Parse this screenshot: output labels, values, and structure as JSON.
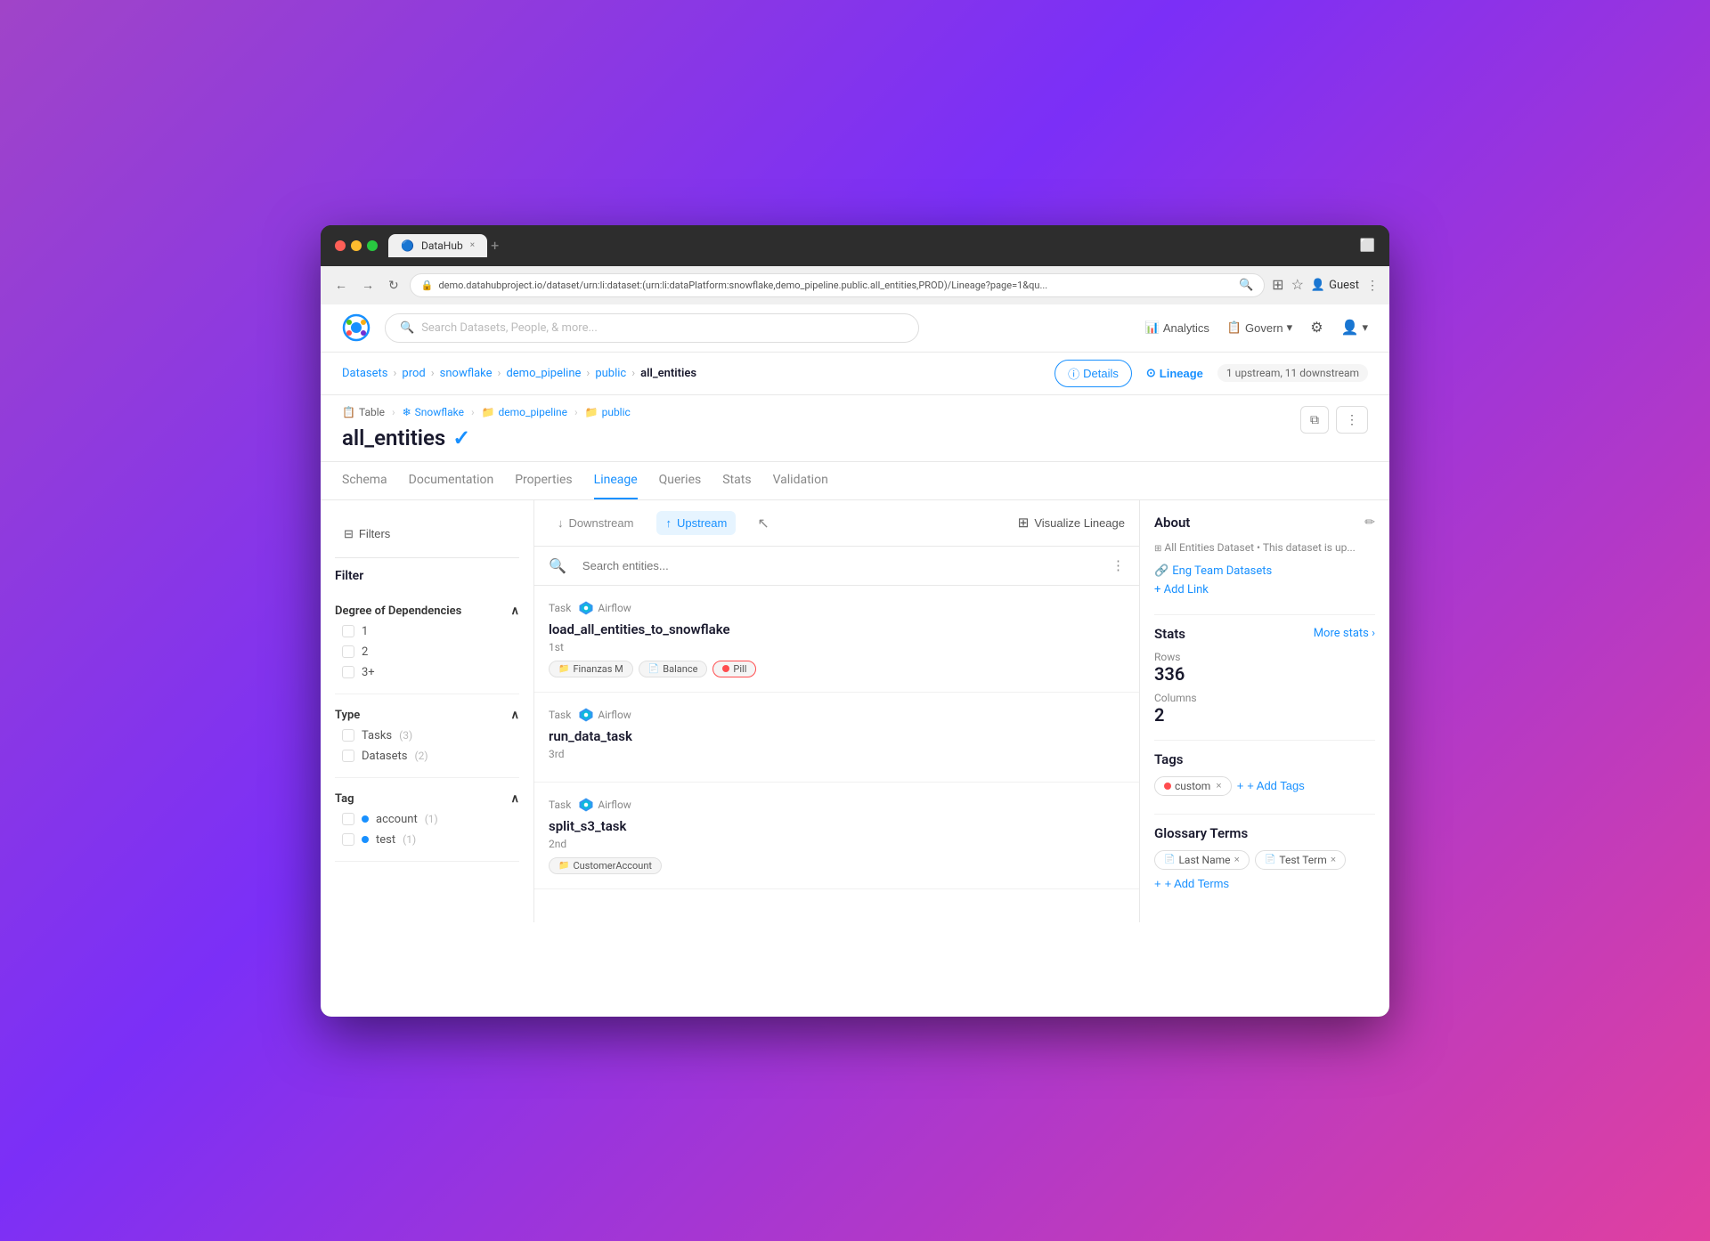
{
  "browser": {
    "tab_title": "DataHub",
    "tab_favicon": "🔵",
    "close_btn": "×",
    "new_tab_btn": "+",
    "url": "demo.datahubproject.io/dataset/urn:li:dataset:(urn:li:dataPlatform:snowflake,demo_pipeline.public.all_entities,PROD)/Lineage?page=1&qu...",
    "nav": {
      "back": "←",
      "forward": "→",
      "refresh": "↻",
      "more": "⋮"
    },
    "guest_label": "Guest",
    "more_btn": "⋮"
  },
  "header": {
    "search_placeholder": "Search Datasets, People, & more...",
    "analytics_label": "Analytics",
    "govern_label": "Govern",
    "settings_icon": "⚙",
    "user_icon": "👤"
  },
  "breadcrumb": {
    "items": [
      "Datasets",
      "prod",
      "snowflake",
      "demo_pipeline",
      "public",
      "all_entities"
    ],
    "separators": [
      ">",
      ">",
      ">",
      ">",
      ">"
    ]
  },
  "entity_nav": {
    "details_label": "Details",
    "lineage_label": "Lineage",
    "lineage_count": "1 upstream, 11 downstream"
  },
  "entity": {
    "meta": {
      "type": "Table",
      "platform": "Snowflake",
      "container1": "demo_pipeline",
      "container2": "public"
    },
    "title": "all_entities",
    "verified": true
  },
  "tabs": [
    {
      "id": "schema",
      "label": "Schema"
    },
    {
      "id": "documentation",
      "label": "Documentation"
    },
    {
      "id": "properties",
      "label": "Properties"
    },
    {
      "id": "lineage",
      "label": "Lineage",
      "active": true
    },
    {
      "id": "queries",
      "label": "Queries"
    },
    {
      "id": "stats",
      "label": "Stats"
    },
    {
      "id": "validation",
      "label": "Validation"
    }
  ],
  "lineage_toolbar": {
    "downstream_label": "Downstream",
    "upstream_label": "Upstream",
    "visualize_label": "Visualize Lineage",
    "active": "upstream"
  },
  "filter_panel": {
    "title": "Filter",
    "filters_label": "Filters",
    "sections": [
      {
        "id": "degree",
        "title": "Degree of Dependencies",
        "options": [
          {
            "label": "1",
            "count": null
          },
          {
            "label": "2",
            "count": null
          },
          {
            "label": "3+",
            "count": null
          }
        ]
      },
      {
        "id": "type",
        "title": "Type",
        "options": [
          {
            "label": "Tasks",
            "count": "(3)"
          },
          {
            "label": "Datasets",
            "count": "(2)"
          }
        ]
      },
      {
        "id": "tag",
        "title": "Tag",
        "options": [
          {
            "label": "account",
            "count": "(1)",
            "color": "#1890ff"
          },
          {
            "label": "test",
            "count": "(1)",
            "color": "#1890ff"
          }
        ]
      }
    ]
  },
  "lineage_items": [
    {
      "type": "Task",
      "platform": "Airflow",
      "name": "load_all_entities_to_snowflake",
      "degree": "1st",
      "tags": [
        {
          "label": "Finanzas M",
          "type": "normal"
        },
        {
          "label": "Balance",
          "type": "normal"
        },
        {
          "label": "Pill",
          "type": "pill",
          "color": "#ff4d4f"
        }
      ]
    },
    {
      "type": "Task",
      "platform": "Airflow",
      "name": "run_data_task",
      "degree": "3rd",
      "tags": []
    },
    {
      "type": "Task",
      "platform": "Airflow",
      "name": "split_s3_task",
      "degree": "2nd",
      "tags": [
        {
          "label": "CustomerAccount",
          "type": "normal"
        }
      ]
    }
  ],
  "right_panel": {
    "about": {
      "title": "About",
      "edit_icon": "✏",
      "entity_name": "All Entities Dataset",
      "description": "This dataset is up...",
      "link": "Eng Team Datasets",
      "add_link_label": "+ Add Link"
    },
    "stats": {
      "title": "Stats",
      "more_stats_label": "More stats ›",
      "rows_label": "Rows",
      "rows_value": "336",
      "columns_label": "Columns",
      "columns_value": "2"
    },
    "tags": {
      "title": "Tags",
      "custom_tag": "custom",
      "custom_color": "#ff4d4f",
      "add_tags_label": "+ Add Tags"
    },
    "glossary": {
      "title": "Glossary Terms",
      "terms": [
        {
          "label": "Last Name"
        },
        {
          "label": "Test Term"
        }
      ],
      "add_terms_label": "+ Add Terms"
    }
  },
  "search_entities_placeholder": "Search entities...",
  "icons": {
    "downstream_arrow": "↓",
    "upstream_arrow": "↑",
    "filter_icon": "⊟",
    "visualize_icon": "⊞",
    "search_icon": "🔍",
    "more_icon": "⋮",
    "info_icon": "ⓘ",
    "lineage_icon": "⊙",
    "link_icon": "🔗",
    "add_icon": "+",
    "close_icon": "×",
    "chevron_up": "∧",
    "chevron_down": "∨",
    "copy_icon": "⧉",
    "lock_icon": "🔒"
  }
}
